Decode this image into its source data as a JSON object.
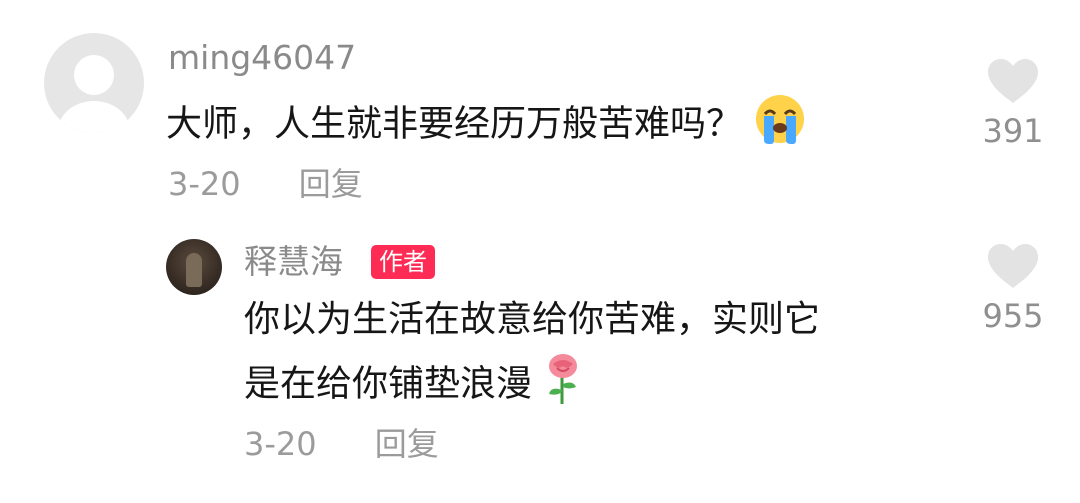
{
  "comments": [
    {
      "username": "ming46047",
      "text": "大师，人生就非要经历万般苦难吗？",
      "emoji": "loudly-crying-face",
      "date": "3-20",
      "reply_label": "回复",
      "likes": "391"
    }
  ],
  "reply": {
    "username": "释慧海",
    "author_tag": "作者",
    "text_line1": "你以为生活在故意给你苦难，实则它",
    "text_line2": "是在给你铺垫浪漫",
    "emoji": "rose",
    "date": "3-20",
    "reply_label": "回复",
    "likes": "955"
  },
  "colors": {
    "author_tag_bg": "#fe2c55",
    "username": "#8a8a8a",
    "text": "#161616",
    "meta": "#9b9b9b",
    "heart": "#e3e3e3"
  }
}
